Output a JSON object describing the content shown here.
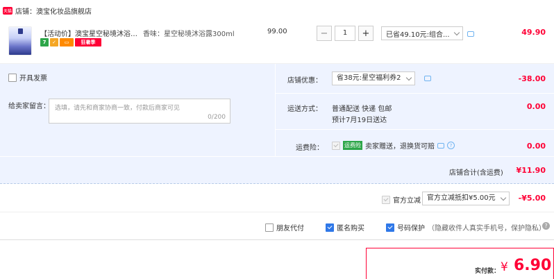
{
  "store": {
    "badge": "天猫",
    "label": "店铺：",
    "name": "澳宝化妆品旗舰店"
  },
  "item": {
    "title": "【活动价】澳宝星空秘境沐浴露...",
    "sku": "香味：星空秘境沐浴露300ml",
    "tags": [
      "7",
      "",
      "",
      "狂暑季"
    ],
    "unit_price": "99.00",
    "quantity": "1",
    "qty_minus": "−",
    "qty_plus": "+",
    "discount_select": "已省49.10元:组合...",
    "total": "49.90"
  },
  "invoice": {
    "label": "开具发票"
  },
  "message": {
    "label": "给卖家留言：",
    "placeholder": "选填，请先和商家协商一致，付款后商家可见",
    "count": "0/200"
  },
  "coupon": {
    "label": "店铺优惠：",
    "selected": "省38元:星空福利券2",
    "amount": "-38.00"
  },
  "delivery": {
    "label": "运送方式：",
    "method": "普通配送 快递 包邮",
    "eta": "预计7月19日送达",
    "amount": "0.00"
  },
  "insurance": {
    "label": "运费险：",
    "badge": "运费险",
    "desc": "卖家赠送，退换货可赔",
    "amount": "0.00"
  },
  "store_total": {
    "label": "店铺合计(含运费)",
    "amount": "¥11.90"
  },
  "official": {
    "label": "官方立减",
    "selected": "官方立减抵扣¥5.00元",
    "amount": "-¥5.00"
  },
  "options": {
    "friend_pay": "朋友代付",
    "anonymous": "匿名购买",
    "privacy": "号码保护",
    "privacy_desc": "（隐藏收件人真实手机号，保护隐私）"
  },
  "payment": {
    "label": "实付款：",
    "currency": "¥",
    "amount": "6.90"
  },
  "colors": {
    "accent": "#ff0036",
    "panel": "#eef3ff",
    "link_blue": "#2f78e8",
    "green": "#2da649"
  }
}
